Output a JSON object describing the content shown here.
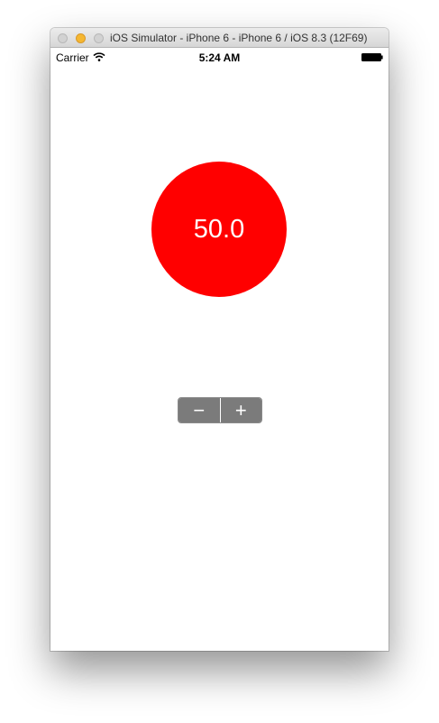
{
  "window": {
    "title": "iOS Simulator - iPhone 6 - iPhone 6 / iOS 8.3 (12F69)"
  },
  "statusbar": {
    "carrier": "Carrier",
    "time": "5:24 AM",
    "icons": [
      "wifi-icon",
      "battery-icon"
    ]
  },
  "gauge": {
    "value_text": "50.0",
    "color": "#ff0000"
  },
  "stepper": {
    "decrement_label": "−",
    "increment_label": "+",
    "tint": "#7b7b7b"
  }
}
